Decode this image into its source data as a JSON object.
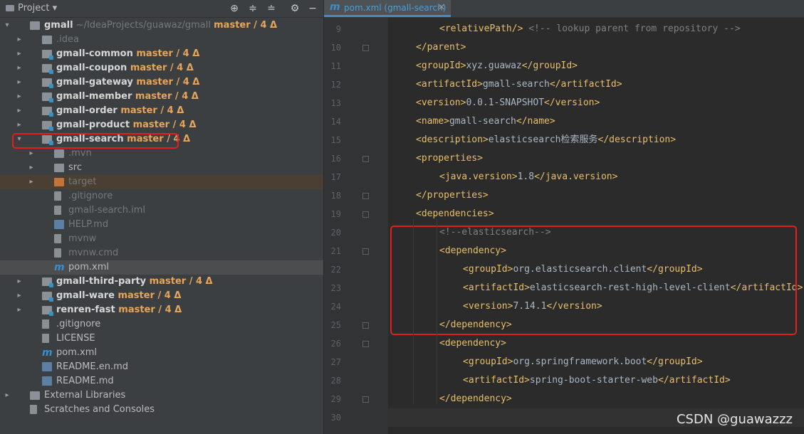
{
  "project_panel": {
    "title": "Project",
    "toolbar_icons": [
      "crosshair-icon",
      "collapse-icon",
      "expand-icon",
      "gear-icon",
      "minimize-icon"
    ]
  },
  "tree": [
    {
      "depth": 0,
      "arrow": "▾",
      "icon": "folder",
      "name": "gmall",
      "suffix": " ~/IdeaProjects/guawaz/gmall",
      "branch": "master / 4 Δ",
      "bold": true
    },
    {
      "depth": 1,
      "arrow": "▸",
      "icon": "folder",
      "name": ".idea",
      "dim": true
    },
    {
      "depth": 1,
      "arrow": "▸",
      "icon": "folder-mod",
      "name": "gmall-common",
      "branch": "master / 4 Δ",
      "bold": true
    },
    {
      "depth": 1,
      "arrow": "▸",
      "icon": "folder-mod",
      "name": "gmall-coupon",
      "branch": "master / 4 Δ",
      "bold": true
    },
    {
      "depth": 1,
      "arrow": "▸",
      "icon": "folder-mod",
      "name": "gmall-gateway",
      "branch": "master / 4 Δ",
      "bold": true
    },
    {
      "depth": 1,
      "arrow": "▸",
      "icon": "folder-mod",
      "name": "gmall-member",
      "branch": "master / 4 Δ",
      "bold": true
    },
    {
      "depth": 1,
      "arrow": "▸",
      "icon": "folder-mod",
      "name": "gmall-order",
      "branch": "master / 4 Δ",
      "bold": true
    },
    {
      "depth": 1,
      "arrow": "▸",
      "icon": "folder-mod",
      "name": "gmall-product",
      "branch": "master / 4 Δ",
      "bold": true
    },
    {
      "depth": 1,
      "arrow": "▾",
      "icon": "folder-mod",
      "name": "gmall-search",
      "branch": "master / 4 Δ",
      "bold": true,
      "highlight": true
    },
    {
      "depth": 2,
      "arrow": "▸",
      "icon": "folder",
      "name": ".mvn",
      "dim": true
    },
    {
      "depth": 2,
      "arrow": "▸",
      "icon": "folder",
      "name": "src"
    },
    {
      "depth": 2,
      "arrow": "▸",
      "icon": "folder-orange",
      "name": "target",
      "dim": true,
      "target": true
    },
    {
      "depth": 2,
      "icon": "file",
      "name": ".gitignore",
      "dim": true
    },
    {
      "depth": 2,
      "icon": "file",
      "name": "gmall-search.iml",
      "dim": true
    },
    {
      "depth": 2,
      "icon": "md",
      "name": "HELP.md",
      "dim": true
    },
    {
      "depth": 2,
      "icon": "file",
      "name": "mvnw",
      "dim": true
    },
    {
      "depth": 2,
      "icon": "file",
      "name": "mvnw.cmd",
      "dim": true
    },
    {
      "depth": 2,
      "icon": "m",
      "name": "pom.xml",
      "selected": true
    },
    {
      "depth": 1,
      "arrow": "▸",
      "icon": "folder-mod",
      "name": "gmall-third-party",
      "branch": "master / 4 Δ",
      "bold": true
    },
    {
      "depth": 1,
      "arrow": "▸",
      "icon": "folder-mod",
      "name": "gmall-ware",
      "branch": "master / 4 Δ",
      "bold": true
    },
    {
      "depth": 1,
      "arrow": "▸",
      "icon": "folder-mod",
      "name": "renren-fast",
      "branch": "master / 4 Δ",
      "bold": true
    },
    {
      "depth": 1,
      "icon": "file",
      "name": ".gitignore"
    },
    {
      "depth": 1,
      "icon": "file",
      "name": "LICENSE"
    },
    {
      "depth": 1,
      "icon": "m",
      "name": "pom.xml"
    },
    {
      "depth": 1,
      "icon": "md",
      "name": "README.en.md"
    },
    {
      "depth": 1,
      "icon": "md",
      "name": "README.md"
    },
    {
      "depth": 0,
      "arrow": "▸",
      "icon": "lib",
      "name": "External Libraries"
    },
    {
      "depth": 0,
      "icon": "scratch",
      "name": "Scratches and Consoles"
    }
  ],
  "editor": {
    "tab_label": "pom.xml (gmall-search)",
    "lines": [
      {
        "n": "9",
        "indent": 2,
        "parts": [
          [
            "tag",
            "<relativePath/>"
          ],
          [
            "cmt",
            " <!-- lookup parent from repository -->"
          ]
        ]
      },
      {
        "n": "10",
        "indent": 1,
        "fold": true,
        "parts": [
          [
            "tag",
            "</parent>"
          ]
        ]
      },
      {
        "n": "11",
        "indent": 1,
        "parts": [
          [
            "tag",
            "<groupId>"
          ],
          [
            "txt",
            "xyz.guawaz"
          ],
          [
            "tag",
            "</groupId>"
          ]
        ]
      },
      {
        "n": "12",
        "indent": 1,
        "parts": [
          [
            "tag",
            "<artifactId>"
          ],
          [
            "txt",
            "gmall-search"
          ],
          [
            "tag",
            "</artifactId>"
          ]
        ]
      },
      {
        "n": "13",
        "indent": 1,
        "parts": [
          [
            "tag",
            "<version>"
          ],
          [
            "txt",
            "0.0.1-SNAPSHOT"
          ],
          [
            "tag",
            "</version>"
          ]
        ]
      },
      {
        "n": "14",
        "indent": 1,
        "parts": [
          [
            "tag",
            "<name>"
          ],
          [
            "txt",
            "gmall-search"
          ],
          [
            "tag",
            "</name>"
          ]
        ]
      },
      {
        "n": "15",
        "indent": 1,
        "parts": [
          [
            "tag",
            "<description>"
          ],
          [
            "txt",
            "elasticsearch检索服务"
          ],
          [
            "tag",
            "</description>"
          ]
        ]
      },
      {
        "n": "16",
        "indent": 1,
        "fold": true,
        "parts": [
          [
            "tag",
            "<properties>"
          ]
        ]
      },
      {
        "n": "17",
        "indent": 2,
        "parts": [
          [
            "tag",
            "<java.version>"
          ],
          [
            "txt",
            "1.8"
          ],
          [
            "tag",
            "</java.version>"
          ]
        ]
      },
      {
        "n": "18",
        "indent": 1,
        "fold": true,
        "parts": [
          [
            "tag",
            "</properties>"
          ]
        ]
      },
      {
        "n": "19",
        "indent": 1,
        "fold": true,
        "parts": [
          [
            "tag",
            "<dependencies>"
          ]
        ]
      },
      {
        "n": "20",
        "indent": 2,
        "parts": [
          [
            "cmt",
            "<!--elasticsearch-->"
          ]
        ]
      },
      {
        "n": "21",
        "indent": 2,
        "fold": true,
        "parts": [
          [
            "tag",
            "<dependency>"
          ]
        ]
      },
      {
        "n": "22",
        "indent": 3,
        "parts": [
          [
            "tag",
            "<groupId>"
          ],
          [
            "txt",
            "org.elasticsearch.client"
          ],
          [
            "tag",
            "</groupId>"
          ]
        ]
      },
      {
        "n": "23",
        "indent": 3,
        "parts": [
          [
            "tag",
            "<artifactId>"
          ],
          [
            "txt",
            "elasticsearch-rest-high-level-client"
          ],
          [
            "tag",
            "</artifactId>"
          ]
        ]
      },
      {
        "n": "24",
        "indent": 3,
        "parts": [
          [
            "tag",
            "<version>"
          ],
          [
            "txt",
            "7.14.1"
          ],
          [
            "tag",
            "</version>"
          ]
        ]
      },
      {
        "n": "25",
        "indent": 2,
        "fold": true,
        "parts": [
          [
            "tag",
            "</dependency>"
          ]
        ]
      },
      {
        "n": "26",
        "indent": 2,
        "fold": true,
        "parts": [
          [
            "tag",
            "<dependency>"
          ]
        ]
      },
      {
        "n": "27",
        "indent": 3,
        "parts": [
          [
            "tag",
            "<groupId>"
          ],
          [
            "txt",
            "org.springframework.boot"
          ],
          [
            "tag",
            "</groupId>"
          ]
        ]
      },
      {
        "n": "28",
        "indent": 3,
        "parts": [
          [
            "tag",
            "<artifactId>"
          ],
          [
            "txt",
            "spring-boot-starter-web"
          ],
          [
            "tag",
            "</artifactId>"
          ]
        ]
      },
      {
        "n": "29",
        "indent": 2,
        "fold": true,
        "parts": [
          [
            "tag",
            "</dependency>"
          ]
        ]
      },
      {
        "n": "30",
        "indent": 0,
        "current": true,
        "parts": []
      }
    ]
  },
  "watermark": "CSDN @guawazzz",
  "colors": {
    "highlight_box": "#e02020",
    "branch": "#e5a55b",
    "tag": "#e8bf6a",
    "comment": "#808080"
  }
}
